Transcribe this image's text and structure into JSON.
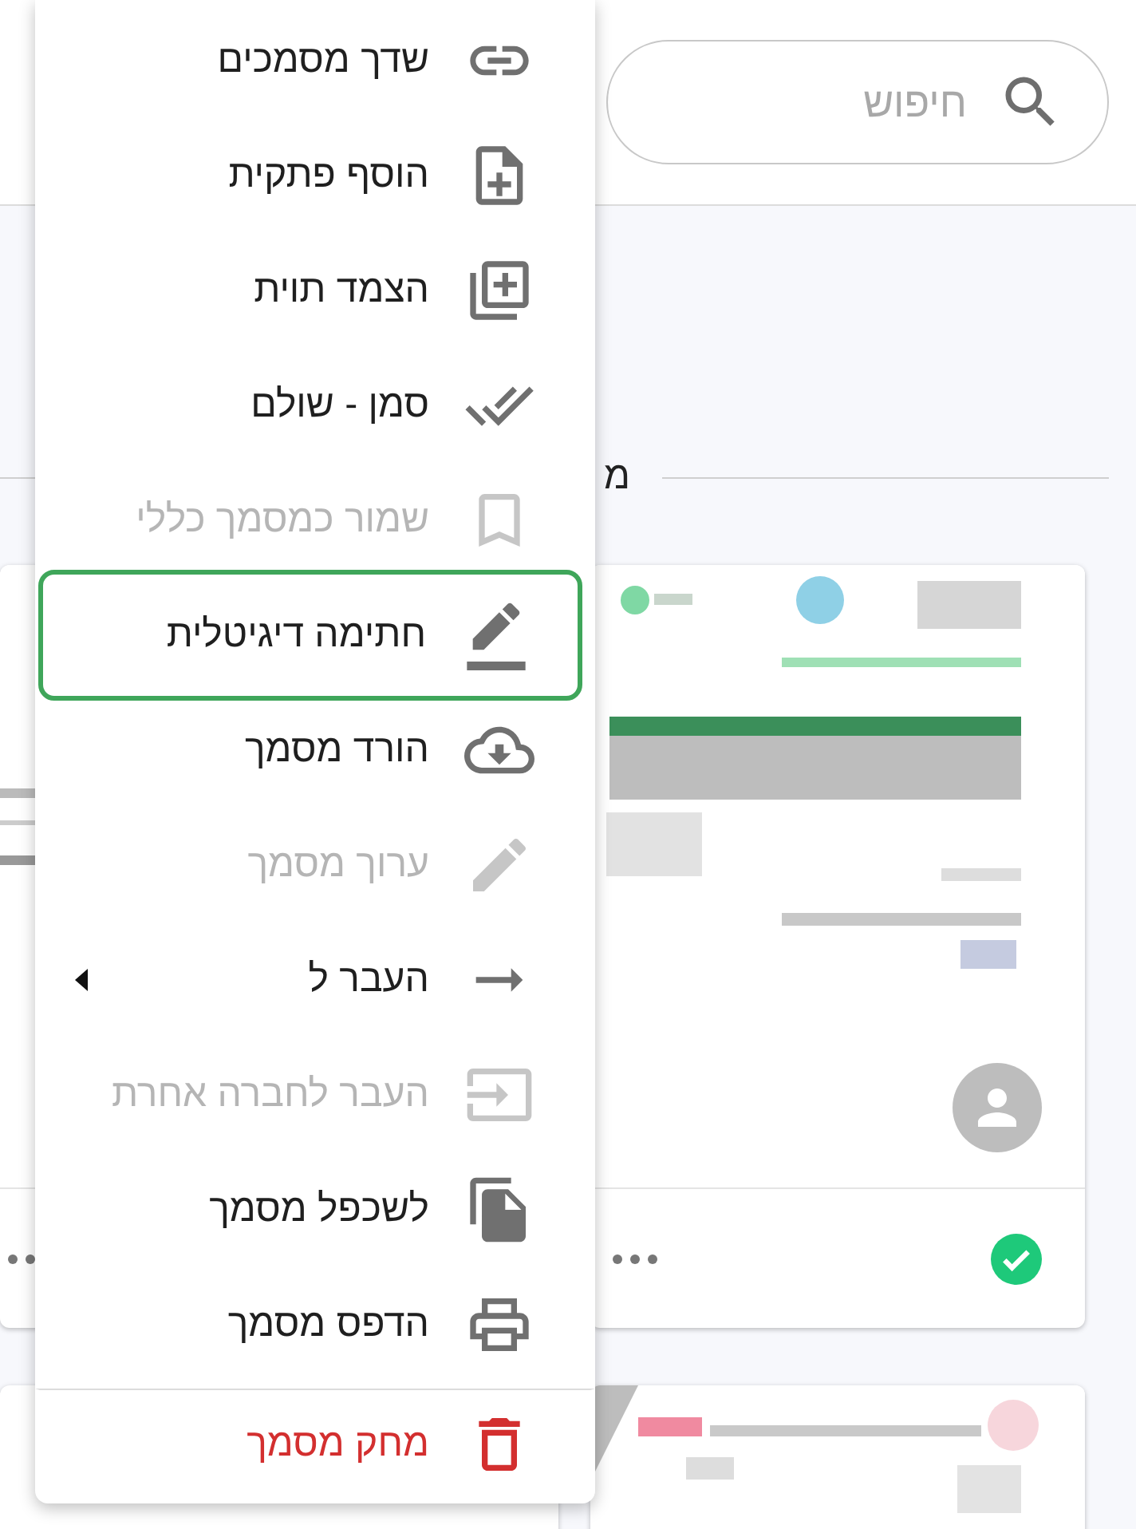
{
  "search": {
    "placeholder": "חיפוש"
  },
  "section": {
    "heading": "מ"
  },
  "menu": {
    "items": [
      {
        "label": "שדך מסמכים",
        "kind": "normal",
        "disabled": false,
        "selected": false,
        "submenu": false,
        "divider_before": false
      },
      {
        "label": "הוסף פתקית",
        "kind": "normal",
        "disabled": false,
        "selected": false,
        "submenu": false,
        "divider_before": false
      },
      {
        "label": "הצמד תוית",
        "kind": "normal",
        "disabled": false,
        "selected": false,
        "submenu": false,
        "divider_before": false
      },
      {
        "label": "סמן - שולם",
        "kind": "normal",
        "disabled": false,
        "selected": false,
        "submenu": false,
        "divider_before": false
      },
      {
        "label": "שמור כמסמך כללי",
        "kind": "normal",
        "disabled": true,
        "selected": false,
        "submenu": false,
        "divider_before": false
      },
      {
        "label": "חתימה דיגיטלית",
        "kind": "normal",
        "disabled": false,
        "selected": true,
        "submenu": false,
        "divider_before": false
      },
      {
        "label": "הורד מסמך",
        "kind": "normal",
        "disabled": false,
        "selected": false,
        "submenu": false,
        "divider_before": false
      },
      {
        "label": "ערוך מסמך",
        "kind": "normal",
        "disabled": true,
        "selected": false,
        "submenu": false,
        "divider_before": false
      },
      {
        "label": "העבר ל",
        "kind": "normal",
        "disabled": false,
        "selected": false,
        "submenu": true,
        "divider_before": false
      },
      {
        "label": "העבר לחברה אחרת",
        "kind": "normal",
        "disabled": true,
        "selected": false,
        "submenu": false,
        "divider_before": false
      },
      {
        "label": "לשכפל מסמך",
        "kind": "normal",
        "disabled": false,
        "selected": false,
        "submenu": false,
        "divider_before": false
      },
      {
        "label": "הדפס מסמך",
        "kind": "normal",
        "disabled": false,
        "selected": false,
        "submenu": false,
        "divider_before": false
      },
      {
        "label": "מחק מסמך",
        "kind": "danger",
        "disabled": false,
        "selected": false,
        "submenu": false,
        "divider_before": true
      }
    ]
  }
}
